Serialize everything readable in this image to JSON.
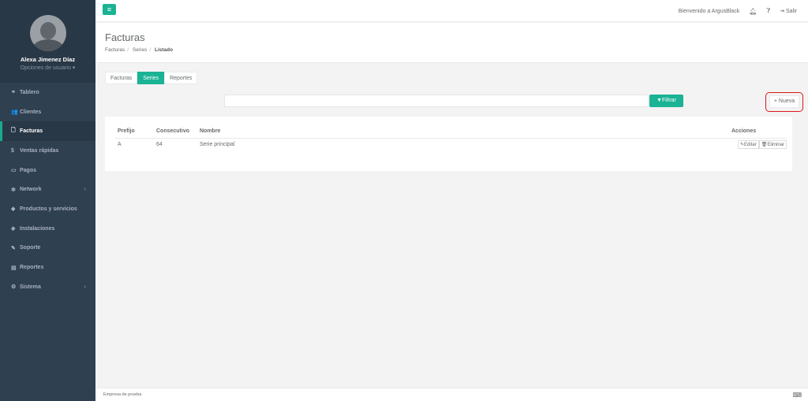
{
  "sidebar": {
    "profile_name": "Alexa Jimenez Díaz",
    "profile_options": "Opciones de usuario ▾",
    "items": [
      {
        "label": "Tablero",
        "icon": "dashboard-icon",
        "glyph": "⚭"
      },
      {
        "label": "Clientes",
        "icon": "users-icon",
        "glyph": "👥"
      },
      {
        "label": "Facturas",
        "icon": "file-icon",
        "glyph": "🗋"
      },
      {
        "label": "Ventas rápidas",
        "icon": "dollar-icon",
        "glyph": "$"
      },
      {
        "label": "Pagos",
        "icon": "money-icon",
        "glyph": "▭"
      },
      {
        "label": "Network",
        "icon": "network-icon",
        "glyph": "✻"
      },
      {
        "label": "Productos y servicios",
        "icon": "tags-icon",
        "glyph": "◆"
      },
      {
        "label": "Instalaciones",
        "icon": "tools-icon",
        "glyph": "◈"
      },
      {
        "label": "Soporte",
        "icon": "wrench-icon",
        "glyph": "✎"
      },
      {
        "label": "Reportes",
        "icon": "book-icon",
        "glyph": "▤"
      },
      {
        "label": "Sistema",
        "icon": "cogs-icon",
        "glyph": "⚙"
      }
    ]
  },
  "topbar": {
    "menu_glyph": "≡",
    "welcome": "Bienvenido a ArgusBlack",
    "logout": "Salir"
  },
  "header": {
    "title": "Facturas",
    "breadcrumb": [
      "Facturas",
      "Series",
      "Listado"
    ]
  },
  "tabs": [
    "Facturas",
    "Series",
    "Reportes"
  ],
  "filter": {
    "button_label": "Filtrar",
    "placeholder": ""
  },
  "new_button": "+ Nueva",
  "table": {
    "headers": [
      "Prefijo",
      "Consecutivo",
      "Nombre",
      "Acciones"
    ],
    "rows": [
      {
        "prefijo": "A",
        "consecutivo": "64",
        "nombre": "Serie principal"
      }
    ],
    "edit_label": "Editar",
    "delete_label": "Eliminar"
  },
  "footer": {
    "company": "Empresa de prueba"
  },
  "colors": {
    "accent": "#1ab394",
    "sidebar": "#2f4050",
    "highlight": "#d9161c"
  }
}
